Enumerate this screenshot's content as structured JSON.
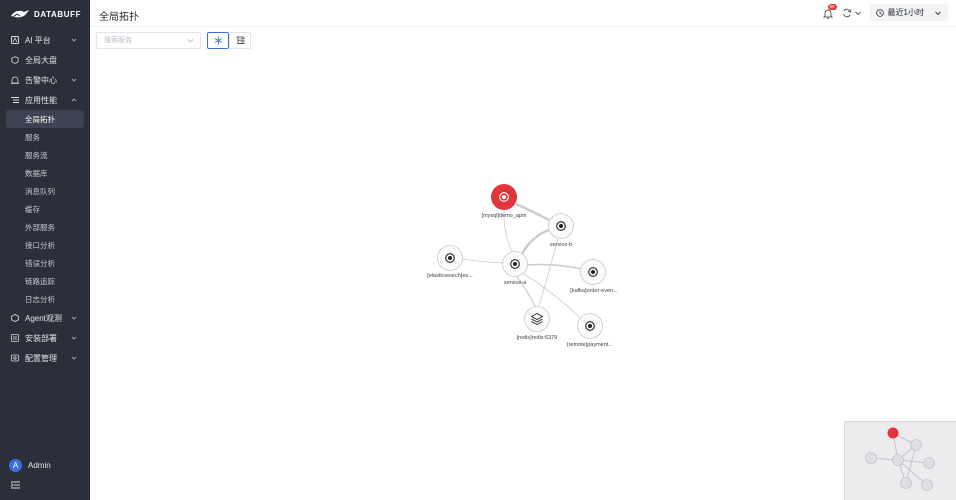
{
  "brand": {
    "name": "DATABUFF"
  },
  "header": {
    "title": "全局拓扑",
    "notification_count": "99",
    "time_range": "最近1小时"
  },
  "toolbar": {
    "search_placeholder": "搜索服务"
  },
  "sidebar": {
    "groups": [
      {
        "label": "AI 平台",
        "icon": "ai-icon",
        "expandable": true
      },
      {
        "label": "全局大盘",
        "icon": "dashboard-icon",
        "expandable": false
      },
      {
        "label": "告警中心",
        "icon": "alarm-icon",
        "expandable": true
      },
      {
        "label": "应用性能",
        "icon": "apm-icon",
        "expandable": true,
        "expanded": true
      },
      {
        "label": "Agent观测",
        "icon": "agent-icon",
        "expandable": true
      },
      {
        "label": "安装部署",
        "icon": "install-icon",
        "expandable": true
      },
      {
        "label": "配置管理",
        "icon": "config-icon",
        "expandable": true
      }
    ],
    "apm_items": [
      "全局拓扑",
      "服务",
      "服务流",
      "数据库",
      "消息队列",
      "缓存",
      "外部服务",
      "接口分析",
      "错误分析",
      "链路追踪",
      "日志分析"
    ],
    "active_item": "全局拓扑",
    "user": {
      "initial": "A",
      "name": "Admin"
    }
  },
  "topology": {
    "nodes": [
      {
        "id": "mysql",
        "label": "[mysql]demo_apm",
        "status": "error",
        "icon": "target-icon"
      },
      {
        "id": "service-b",
        "label": "service-b",
        "status": "normal",
        "icon": "target-icon"
      },
      {
        "id": "elastic",
        "label": "[elasticsearch]es...",
        "status": "normal",
        "icon": "target-icon"
      },
      {
        "id": "service-a",
        "label": "service-a",
        "status": "normal",
        "icon": "target-icon"
      },
      {
        "id": "kafka",
        "label": "[kafka]order-even...",
        "status": "normal",
        "icon": "target-icon"
      },
      {
        "id": "redis",
        "label": "[redis]redis:6379",
        "status": "normal",
        "icon": "layers-icon"
      },
      {
        "id": "remote",
        "label": "[remote]payment...",
        "status": "normal",
        "icon": "target-icon"
      }
    ],
    "edges": [
      {
        "from": "service-b",
        "to": "mysql"
      },
      {
        "from": "service-a",
        "to": "mysql"
      },
      {
        "from": "service-a",
        "to": "service-b"
      },
      {
        "from": "service-a",
        "to": "elastic"
      },
      {
        "from": "service-a",
        "to": "kafka"
      },
      {
        "from": "service-a",
        "to": "redis"
      },
      {
        "from": "service-a",
        "to": "remote"
      },
      {
        "from": "service-b",
        "to": "redis"
      }
    ]
  },
  "colors": {
    "sidebar_bg": "#2b2f3a",
    "accent": "#3b6fe0",
    "error": "#e0353b"
  }
}
